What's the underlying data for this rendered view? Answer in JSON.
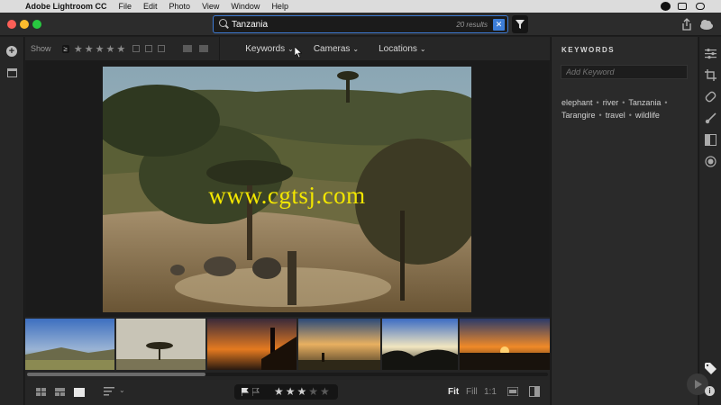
{
  "menubar": {
    "app_name": "Adobe Lightroom CC",
    "menus": [
      "File",
      "Edit",
      "Photo",
      "View",
      "Window",
      "Help"
    ]
  },
  "search": {
    "query": "Tanzania",
    "result_count": "20 results"
  },
  "toolbar": {
    "show_label": "Show",
    "rating_operator": "≥",
    "keywords_label": "Keywords",
    "cameras_label": "Cameras",
    "locations_label": "Locations"
  },
  "viewer": {
    "watermark_text": "www.cgtsj.com"
  },
  "filmstrip": {
    "thumbnail_count": 6,
    "scroll_fraction_visible": 0.34
  },
  "bottombar": {
    "rating_stars_filled": 3,
    "rating_stars_total": 5,
    "zoom_fit": "Fit",
    "zoom_fill": "Fill",
    "zoom_1to1": "1:1"
  },
  "keywords_panel": {
    "title": "KEYWORDS",
    "add_placeholder": "Add Keyword",
    "keywords": [
      "elephant",
      "river",
      "Tanzania",
      "Tarangire",
      "travel",
      "wildlife"
    ]
  },
  "colors": {
    "accent": "#3c7dd8",
    "watermark": "#f2e600",
    "panel_bg": "#2a2a2a"
  }
}
